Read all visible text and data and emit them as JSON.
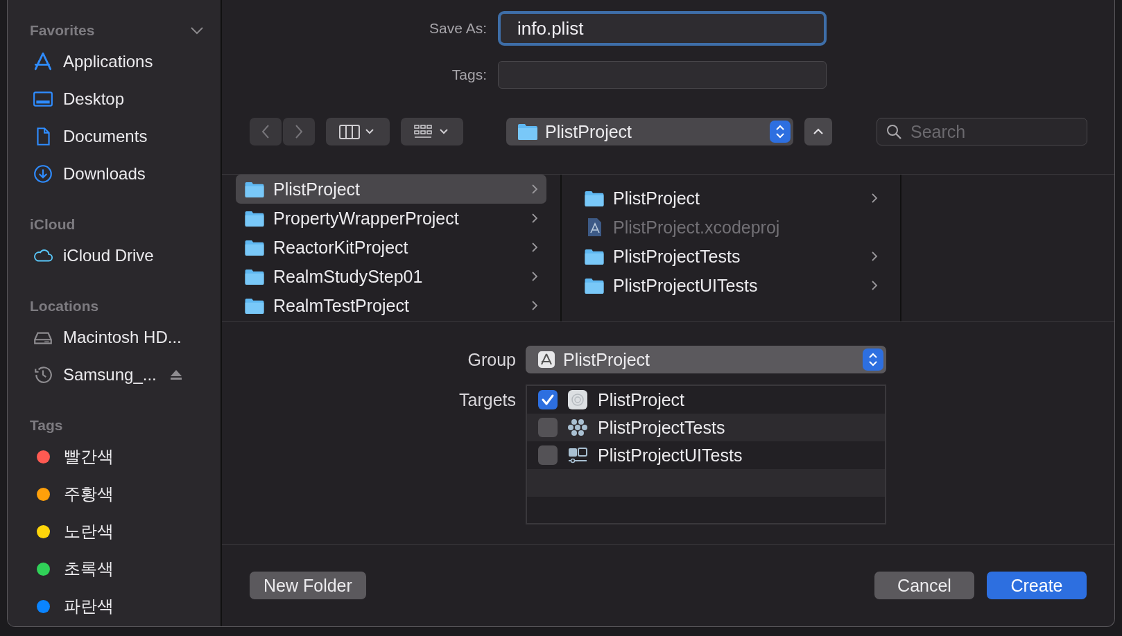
{
  "sidebar": {
    "sections": [
      {
        "kind": "places",
        "title": "Favorites",
        "collapsible": true,
        "items": [
          {
            "name": "Applications"
          },
          {
            "name": "Desktop"
          },
          {
            "name": "Documents"
          },
          {
            "name": "Downloads"
          }
        ]
      },
      {
        "kind": "places",
        "title": "iCloud",
        "items": [
          {
            "name": "iCloud Drive"
          }
        ]
      },
      {
        "kind": "places",
        "title": "Locations",
        "items": [
          {
            "name": "Macintosh HD..."
          },
          {
            "name": "Samsung_...",
            "ejectable": true
          }
        ]
      },
      {
        "kind": "tags",
        "title": "Tags",
        "items": [
          {
            "name": "빨간색",
            "color": "#ff5a52"
          },
          {
            "name": "주황색",
            "color": "#ffa00a"
          },
          {
            "name": "노란색",
            "color": "#ffd60a"
          },
          {
            "name": "초록색",
            "color": "#30d158"
          },
          {
            "name": "파란색",
            "color": "#0a84ff"
          }
        ]
      }
    ]
  },
  "save_as": {
    "label": "Save As:",
    "value": "info.plist"
  },
  "tags_field": {
    "label": "Tags:"
  },
  "toolbar": {
    "location": "PlistProject",
    "search": {
      "placeholder": "Search"
    }
  },
  "browser": {
    "columns": [
      {
        "items": [
          {
            "name": "PlistProject",
            "kind": "folder",
            "selected": true,
            "disabled": false
          },
          {
            "name": "PropertyWrapperProject",
            "kind": "folder",
            "selected": false,
            "disabled": false
          },
          {
            "name": "ReactorKitProject",
            "kind": "folder",
            "selected": false,
            "disabled": false
          },
          {
            "name": "RealmStudyStep01",
            "kind": "folder",
            "selected": false,
            "disabled": false
          },
          {
            "name": "RealmTestProject",
            "kind": "folder",
            "selected": false,
            "disabled": false
          }
        ]
      },
      {
        "items": [
          {
            "name": "PlistProject",
            "kind": "folder",
            "selected": false,
            "disabled": false
          },
          {
            "name": "PlistProject.xcodeproj",
            "kind": "project",
            "selected": false,
            "disabled": true
          },
          {
            "name": "PlistProjectTests",
            "kind": "folder",
            "selected": false,
            "disabled": false
          },
          {
            "name": "PlistProjectUITests",
            "kind": "folder",
            "selected": false,
            "disabled": false
          }
        ]
      }
    ]
  },
  "group": {
    "label": "Group",
    "value": "PlistProject"
  },
  "targets": {
    "label": "Targets",
    "items": [
      {
        "name": "PlistProject",
        "checked": true
      },
      {
        "name": "PlistProjectTests",
        "checked": false
      },
      {
        "name": "PlistProjectUITests",
        "checked": false
      }
    ]
  },
  "buttons": {
    "new_folder": "New Folder",
    "cancel": "Cancel",
    "create": "Create"
  }
}
